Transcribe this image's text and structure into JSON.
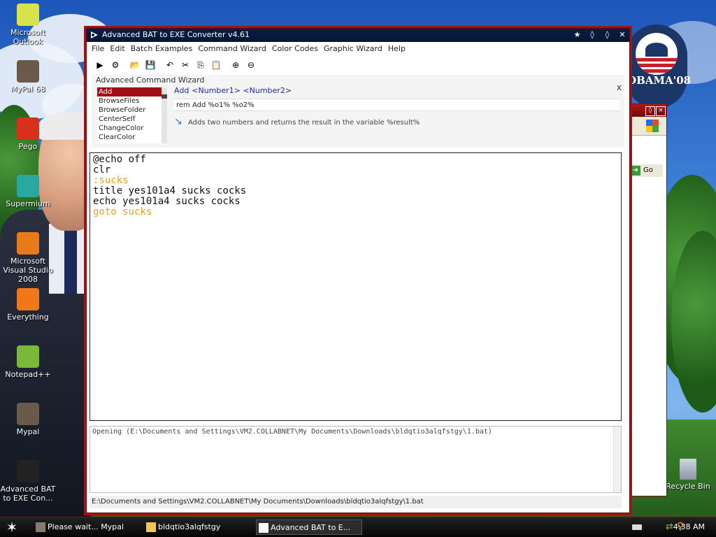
{
  "desktop": {
    "icons": [
      {
        "label": "Microsoft Outlook",
        "icon": "outlook-icon",
        "color": "#d8e24a"
      },
      {
        "label": "MyPal 68",
        "icon": "mypal-icon",
        "color": "#6a5a4a"
      },
      {
        "label": "Pego",
        "icon": "pego-icon",
        "color": "#d8301a"
      },
      {
        "label": "Supermium",
        "icon": "supermium-icon",
        "color": "#28a8a0"
      },
      {
        "label": "Microsoft Visual Studio 2008",
        "icon": "visual-studio-icon",
        "color": "#e87a1a"
      },
      {
        "label": "Everything",
        "icon": "everything-icon",
        "color": "#f07818"
      },
      {
        "label": "Notepad++",
        "icon": "notepadpp-icon",
        "color": "#7ab83a"
      },
      {
        "label": "Mypal",
        "icon": "mypal-icon",
        "color": "#6a5a4a"
      },
      {
        "label": "Advanced BAT to EXE Con...",
        "icon": "bat-to-exe-icon",
        "color": "#222222"
      }
    ],
    "recycle_bin": "Recycle Bin",
    "wallpaper_text": "OBAMA'08"
  },
  "bg_window": {
    "go_label": "Go"
  },
  "window": {
    "title": "Advanced BAT to EXE Converter v4.61",
    "menu": [
      "File",
      "Edit",
      "Batch Examples",
      "Command Wizard",
      "Color Codes",
      "Graphic Wizard",
      "Help"
    ],
    "toolbar": [
      {
        "icon": "run-icon",
        "glyph": "▶"
      },
      {
        "icon": "compile-icon",
        "glyph": "⚙"
      },
      {
        "icon": "open-folder-icon",
        "glyph": "📂"
      },
      {
        "icon": "save-icon",
        "glyph": "💾"
      },
      {
        "icon": "undo-icon",
        "glyph": "↶"
      },
      {
        "icon": "cut-icon",
        "glyph": "✂"
      },
      {
        "icon": "copy-icon",
        "glyph": "⎘"
      },
      {
        "icon": "paste-icon",
        "glyph": "📋"
      },
      {
        "icon": "zoom-in-icon",
        "glyph": "⊕"
      },
      {
        "icon": "zoom-out-icon",
        "glyph": "⊖"
      }
    ]
  },
  "wizard": {
    "title": "Advanced Command Wizard",
    "close": "x",
    "commands": [
      "Add",
      "BrowseFiles",
      "BrowseFolder",
      "CenterSelf",
      "ChangeColor",
      "ClearColor"
    ],
    "selected": "Add",
    "syntax_cmd": "Add",
    "syntax_args": "<Number1> <Number2>",
    "rem_line": "rem Add %o1% %o2%",
    "description": "Adds two numbers and returns the result in the variable %result%"
  },
  "editor": {
    "lines": [
      {
        "text": "@echo off",
        "kind": "normal"
      },
      {
        "text": "clr",
        "kind": "normal"
      },
      {
        "text": ":sucks",
        "kind": "label"
      },
      {
        "text": "title yes101a4 sucks cocks",
        "kind": "normal"
      },
      {
        "text": "echo yes101a4 sucks cocks",
        "kind": "normal"
      },
      {
        "text": "goto sucks",
        "kind": "goto"
      }
    ]
  },
  "output": {
    "text": "Opening (E:\\Documents and Settings\\VM2.COLLABNET\\My Documents\\Downloads\\bldqtio3alqfstgy\\1.bat)"
  },
  "statusbar": {
    "path": "E:\\Documents and Settings\\VM2.COLLABNET\\My Documents\\Downloads\\bldqtio3alqfstgy\\1.bat"
  },
  "taskbar": {
    "buttons": [
      {
        "label": "Please wait... Mypal",
        "icon": "mypal-icon"
      },
      {
        "label": "bldqtio3alqfstgy",
        "icon": "folder-icon"
      },
      {
        "label": "Advanced BAT to E...",
        "icon": "bat-to-exe-icon",
        "active": true
      }
    ],
    "clock": "4:38 AM"
  }
}
